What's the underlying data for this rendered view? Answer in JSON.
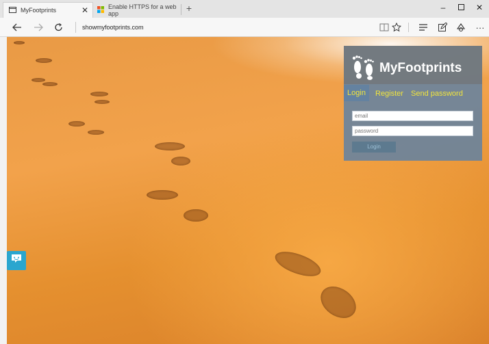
{
  "browser": {
    "tabs": [
      {
        "title": "MyFootprints",
        "active": true
      },
      {
        "title": "Enable HTTPS for a web app",
        "active": false
      }
    ],
    "address": "showmyfootprints.com"
  },
  "page": {
    "brand": "MyFootprints",
    "tabs": [
      "Login",
      "Register",
      "Send password"
    ],
    "email_placeholder": "email",
    "password_placeholder": "password",
    "login_button": "Login"
  },
  "colors": {
    "accent_yellow": "#f2e53c",
    "panel_blue": "#6482a0",
    "chat_blue": "#2aa6cf"
  }
}
